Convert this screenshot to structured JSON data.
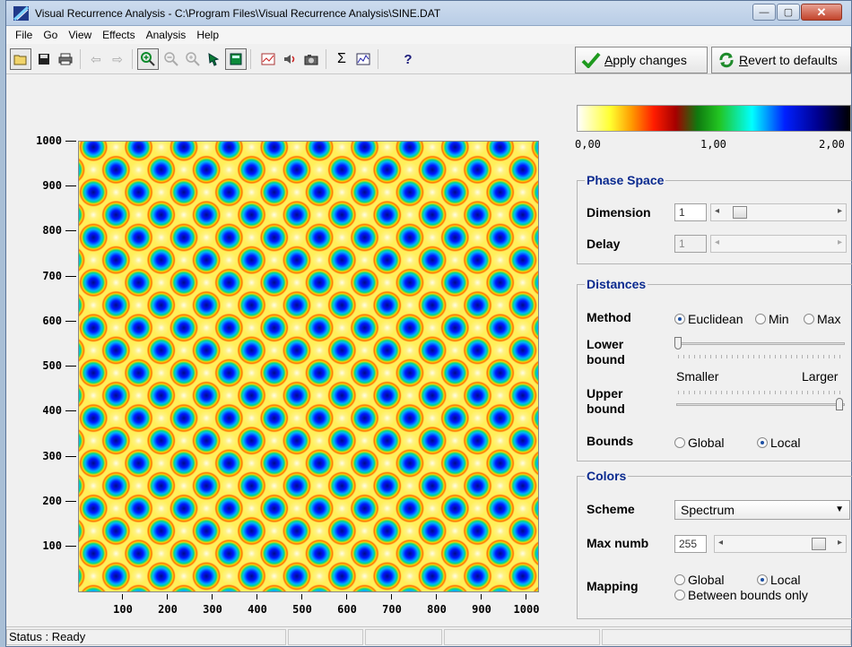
{
  "window": {
    "title": "Visual Recurrence Analysis  -  C:\\Program Files\\Visual Recurrence Analysis\\SINE.DAT",
    "minimize": "—",
    "maximize": "▢",
    "close": "✕"
  },
  "menu": [
    "File",
    "Go",
    "View",
    "Effects",
    "Analysis",
    "Help"
  ],
  "toolbar": {
    "apply_label_u": "A",
    "apply_label_rest": "pply changes",
    "revert_label_u": "R",
    "revert_label_rest": "evert to defaults",
    "help_glyph": "?",
    "sigma_glyph": "Σ"
  },
  "plot": {
    "y_ticks": [
      "1000",
      "900",
      "800",
      "700",
      "600",
      "500",
      "400",
      "300",
      "200",
      "100"
    ],
    "x_ticks": [
      "100",
      "200",
      "300",
      "400",
      "500",
      "600",
      "700",
      "800",
      "900",
      "1000"
    ]
  },
  "colorbar": {
    "min": "0,00",
    "mid": "1,00",
    "max": "2,00"
  },
  "phase_space": {
    "title": "Phase Space",
    "dimension_label": "Dimension",
    "dimension_value": "1",
    "delay_label": "Delay",
    "delay_value": "1"
  },
  "distances": {
    "title": "Distances",
    "method_label": "Method",
    "method_options": [
      "Euclidean",
      "Min",
      "Max"
    ],
    "method_selected": "Euclidean",
    "lower_bound_label_1": "Lower",
    "lower_bound_label_2": "bound",
    "smaller_label": "Smaller",
    "larger_label": "Larger",
    "upper_bound_label_1": "Upper",
    "upper_bound_label_2": "bound",
    "bounds_label": "Bounds",
    "bounds_options": [
      "Global",
      "Local"
    ],
    "bounds_selected": "Local"
  },
  "colors": {
    "title": "Colors",
    "scheme_label": "Scheme",
    "scheme_value": "Spectrum",
    "max_numb_label": "Max numb",
    "max_numb_value": "255",
    "mapping_label": "Mapping",
    "mapping_options": [
      "Global",
      "Local",
      "Between bounds only"
    ],
    "mapping_selected": "Local"
  },
  "status": {
    "text": "Status : Ready"
  }
}
